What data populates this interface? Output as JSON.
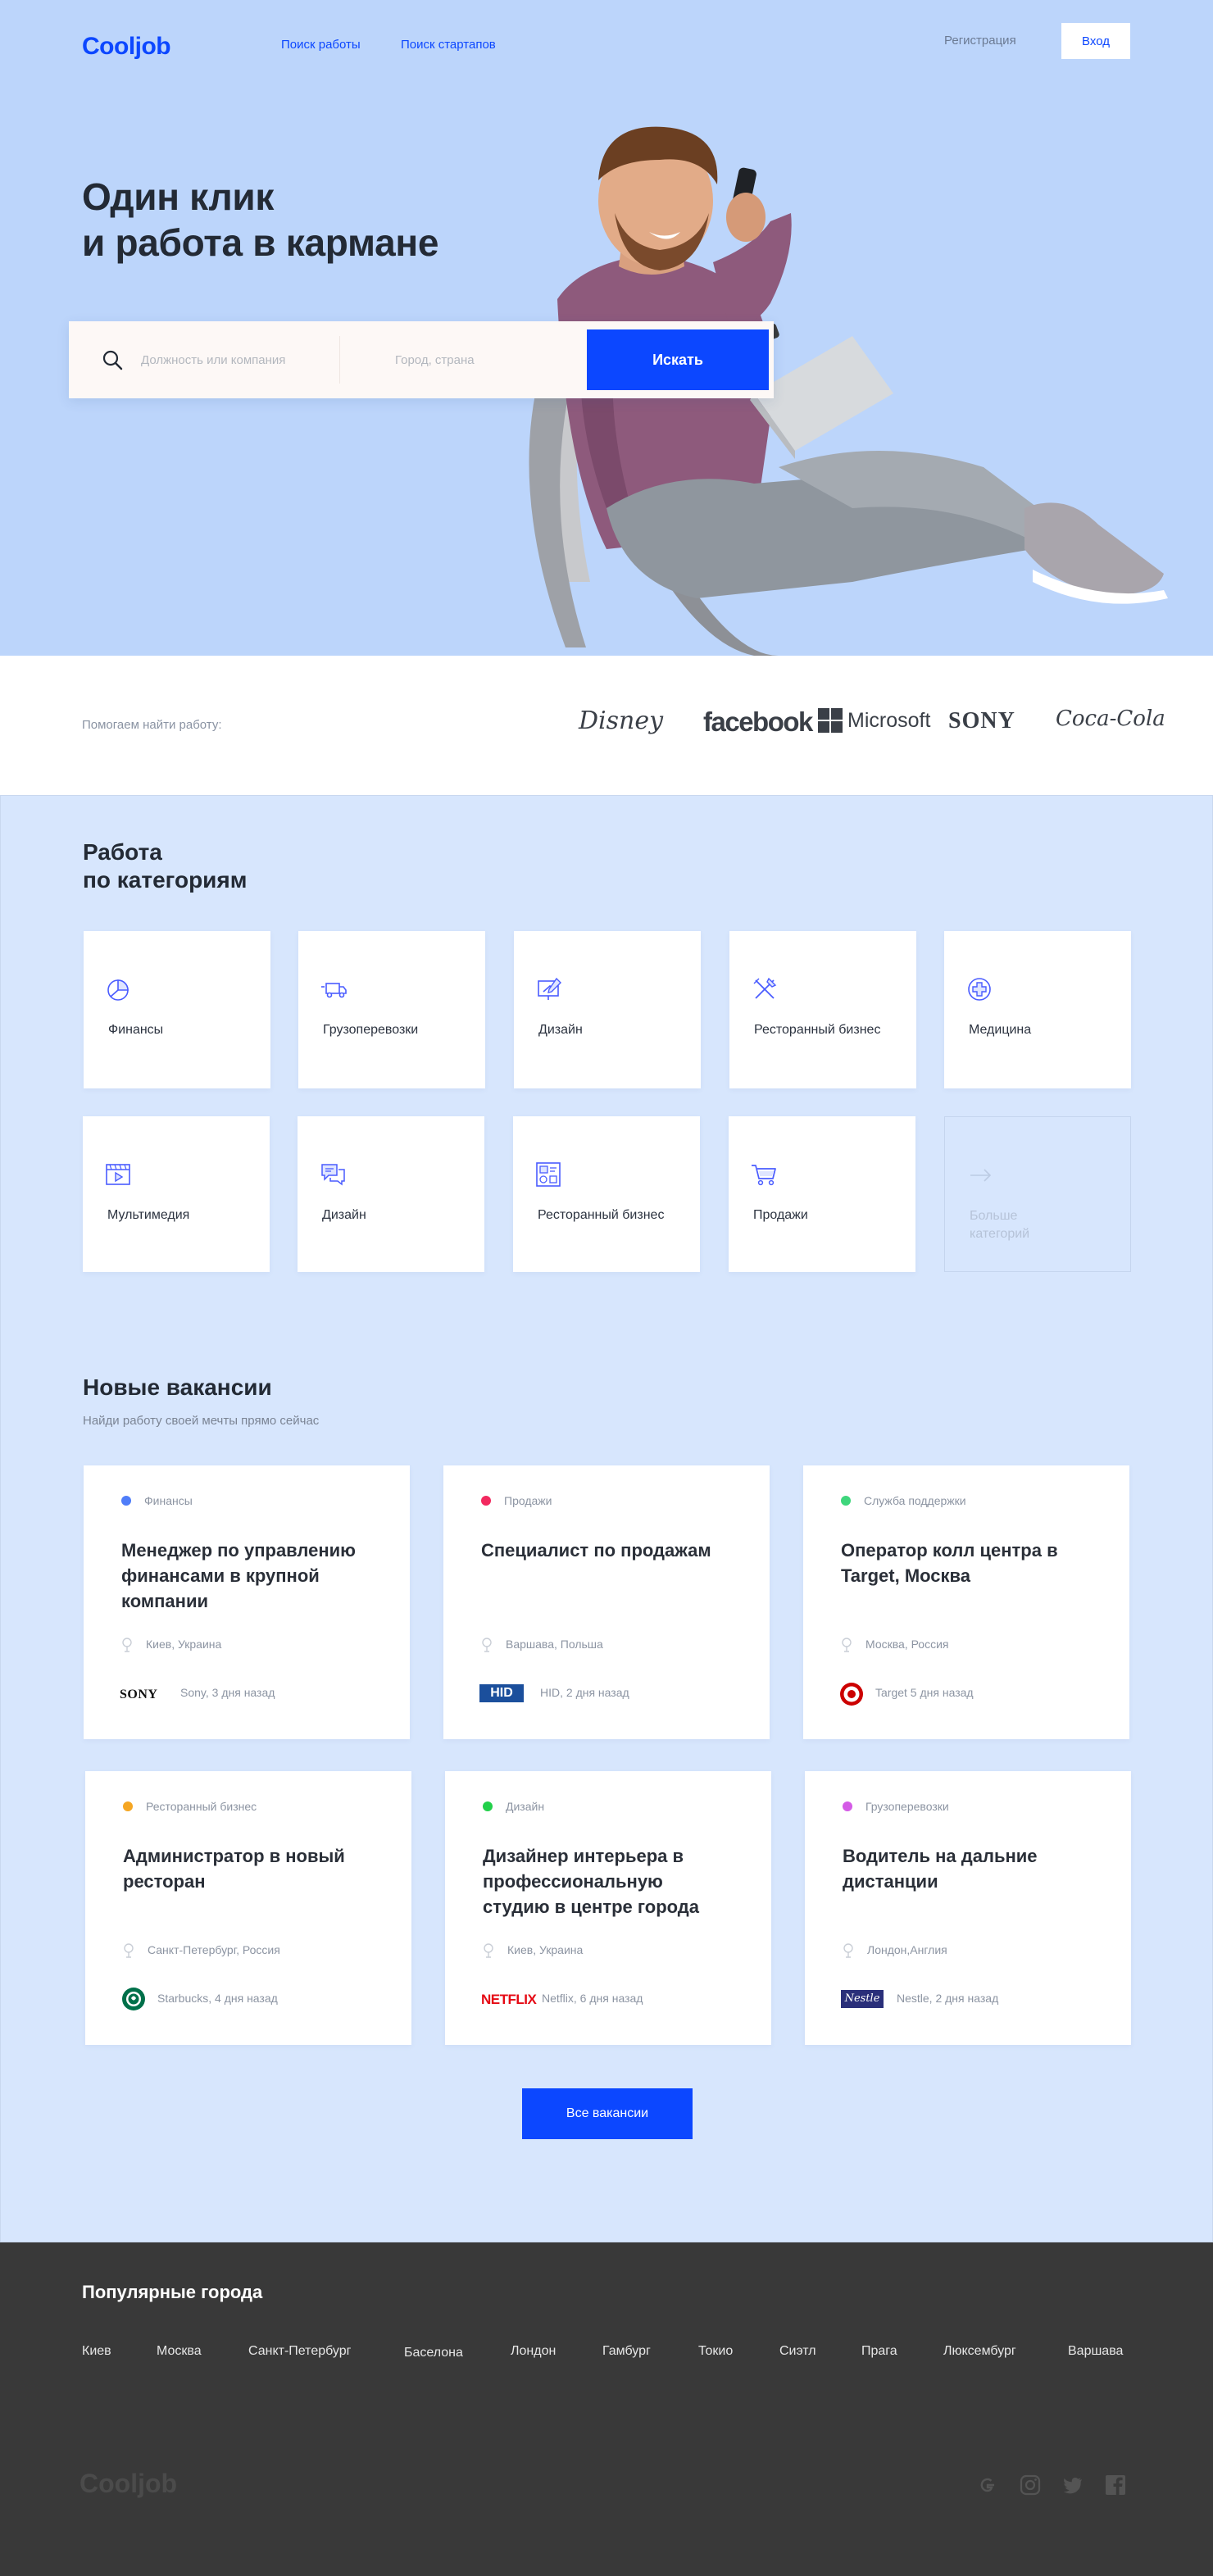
{
  "header": {
    "logo": "Cooljob",
    "nav": [
      "Поиск работы",
      "Поиск стартапов"
    ],
    "register": "Регистрация",
    "login": "Вход"
  },
  "hero": {
    "title_lines": [
      "Один клик",
      "и работа в кармане"
    ],
    "search": {
      "query_placeholder": "Должность или компания",
      "city_placeholder": "Город, страна",
      "button": "Искать"
    }
  },
  "brands": {
    "label": "Помогаем найти работу:",
    "items": [
      "Disney",
      "facebook",
      "Microsoft",
      "SONY",
      "Coca-Cola"
    ]
  },
  "categories": {
    "title_lines": [
      "Работа",
      "по категориям"
    ],
    "items": [
      {
        "label": "Финансы",
        "icon": "pie-chart-icon"
      },
      {
        "label": "Грузоперевозки",
        "icon": "truck-icon"
      },
      {
        "label": "Дизайн",
        "icon": "design-board-icon"
      },
      {
        "label": "Ресторанный бизнес",
        "icon": "fork-knife-icon"
      },
      {
        "label": "Медицина",
        "icon": "medical-cross-icon"
      },
      {
        "label": "Мультимедия",
        "icon": "video-player-icon"
      },
      {
        "label": "Дизайн",
        "icon": "chat-bubbles-icon"
      },
      {
        "label": "Ресторанный бизнес",
        "icon": "dashboard-icon"
      },
      {
        "label": "Продажи",
        "icon": "cart-icon"
      }
    ],
    "more": "Больше категорий"
  },
  "vacancies": {
    "title": "Новые вакансии",
    "subtitle": "Найди работу своей мечты прямо сейчас",
    "jobs": [
      {
        "category": "Финансы",
        "color": "#4f7df9",
        "title": "Менеджер по управлению финансами в крупной компании",
        "location": "Киев, Украина",
        "company_logo": "SONY",
        "company": "Sony, 3 дня назад"
      },
      {
        "category": "Продажи",
        "color": "#f2295f",
        "title": "Специалист по продажам",
        "location": "Варшава, Польша",
        "company_logo": "HID",
        "company": "HID, 2 дня назад"
      },
      {
        "category": "Служба поддержки",
        "color": "#3ed67c",
        "title": "Оператор колл центра в Target, Москва",
        "location": "Москва, Россия",
        "company_logo": "target-logo",
        "company": "Target 5 дня назад"
      },
      {
        "category": "Ресторанный бизнес",
        "color": "#f5a623",
        "title": "Администратор в новый ресторан",
        "location": "Санкт-Петербург, Россия",
        "company_logo": "starbucks-logo",
        "company": "Starbucks, 4 дня назад"
      },
      {
        "category": "Дизайн",
        "color": "#22d04a",
        "title": "Дизайнер интерьера в профессиональную студию в центре города",
        "location": "Киев, Украина",
        "company_logo": "NETFLIX",
        "company": "Netflix, 6 дня назад"
      },
      {
        "category": "Грузоперевозки",
        "color": "#d45be6",
        "title": "Водитель на дальние дистанции",
        "location": "Лондон,Англия",
        "company_logo": "Nestle",
        "company": "Nestle, 2 дня назад"
      }
    ],
    "all_button": "Все вакансии"
  },
  "footer": {
    "title": "Популярные города",
    "cities": [
      "Киев",
      "Москва",
      "Санкт-Петербург",
      "Баселона",
      "Лондон",
      "Гамбург",
      "Токио",
      "Сиэтл",
      "Прага",
      "Люксембург",
      "Варшава"
    ],
    "logo": "Cooljob",
    "social": [
      "google-icon",
      "instagram-icon",
      "twitter-icon",
      "facebook-icon"
    ]
  },
  "colors": {
    "accent": "#0c47ff",
    "hero_bg": "#bcd5fb",
    "section_bg": "#d7e6fd",
    "footer_bg": "#393939"
  }
}
